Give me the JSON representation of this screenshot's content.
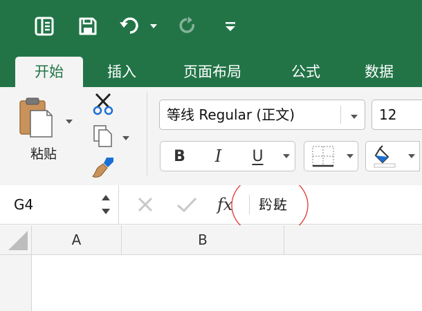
{
  "ribbon_tabs": [
    {
      "label": "开始",
      "active": true
    },
    {
      "label": "插入",
      "active": false
    },
    {
      "label": "页面布局",
      "active": false
    },
    {
      "label": "公式",
      "active": false
    },
    {
      "label": "数据",
      "active": false
    }
  ],
  "clipboard": {
    "paste_label": "粘贴"
  },
  "font": {
    "name": "等线 Regular (正文)",
    "size": "12"
  },
  "format_buttons": {
    "bold": "B",
    "italic": "I",
    "underline": "U"
  },
  "name_box": {
    "value": "G4"
  },
  "formula_bar": {
    "fx_label": "fx",
    "content": "䦇䦈"
  },
  "columns": [
    "A",
    "B"
  ],
  "colors": {
    "brand": "#227447",
    "annotation": "#e0362c"
  }
}
